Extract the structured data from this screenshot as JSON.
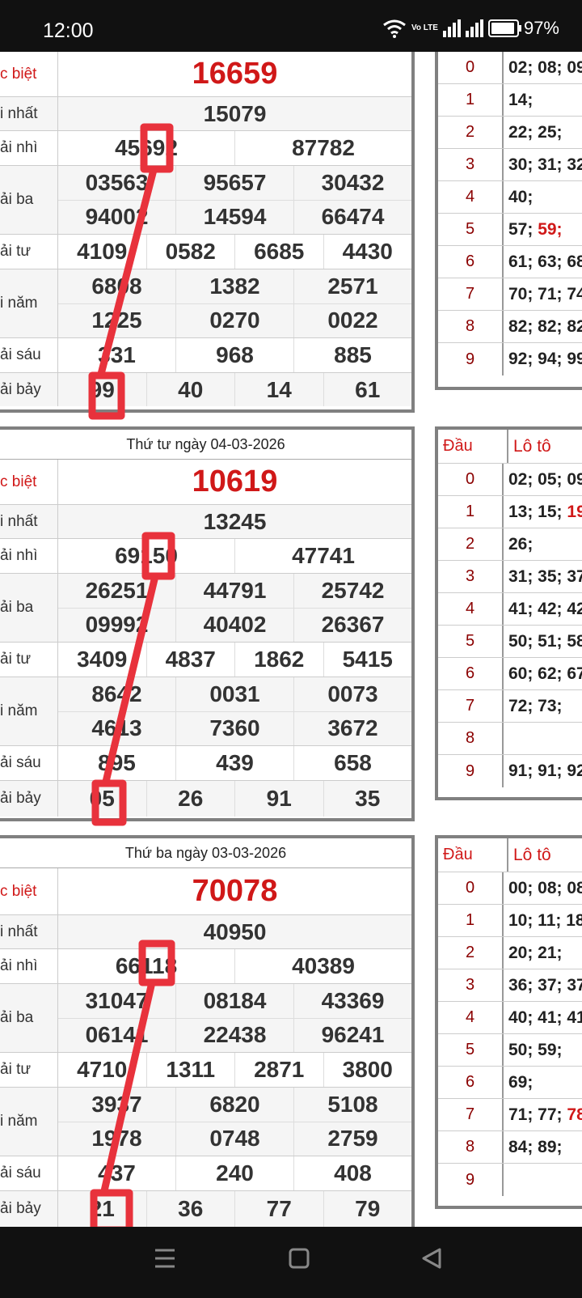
{
  "status": {
    "time": "12:00",
    "network": "Vo LTE",
    "battery": "97%"
  },
  "colors": {
    "accent_red": "#d01818",
    "annotation": "#e8323c"
  },
  "blocks": [
    {
      "title": "",
      "labels": {
        "db": "c biệt",
        "g1": "i nhất",
        "g2": "ải nhì",
        "g3": "ải ba",
        "g4": "ải tư",
        "g5": "i năm",
        "g6": "ải sáu",
        "g7": "ải bảy"
      },
      "db": "16659",
      "g1": "15079",
      "g2": [
        "45692",
        "87782"
      ],
      "g3a": [
        "03563",
        "95657",
        "30432"
      ],
      "g3b": [
        "94002",
        "14594",
        "66474"
      ],
      "g4": [
        "4109",
        "0582",
        "6685",
        "4430"
      ],
      "g5a": [
        "6808",
        "1382",
        "2571"
      ],
      "g5b": [
        "1225",
        "0270",
        "0022"
      ],
      "g6": [
        "331",
        "968",
        "885"
      ],
      "g7": [
        "99",
        "40",
        "14",
        "61"
      ]
    },
    {
      "title": "Thứ tư ngày 04-03-2026",
      "labels": {
        "db": "c biệt",
        "g1": "i nhất",
        "g2": "ải nhì",
        "g3": "ải ba",
        "g4": "ải tư",
        "g5": "i năm",
        "g6": "ải sáu",
        "g7": "ải bảy"
      },
      "db": "10619",
      "g1": "13245",
      "g2": [
        "69150",
        "47741"
      ],
      "g3a": [
        "26251",
        "44791",
        "25742"
      ],
      "g3b": [
        "09992",
        "40402",
        "26367"
      ],
      "g4": [
        "3409",
        "4837",
        "1862",
        "5415"
      ],
      "g5a": [
        "8642",
        "0031",
        "0073"
      ],
      "g5b": [
        "4613",
        "7360",
        "3672"
      ],
      "g6": [
        "895",
        "439",
        "658"
      ],
      "g7": [
        "05",
        "26",
        "91",
        "35"
      ]
    },
    {
      "title": "Thứ ba ngày 03-03-2026",
      "labels": {
        "db": "c biệt",
        "g1": "i nhất",
        "g2": "ải nhì",
        "g3": "ải ba",
        "g4": "ải tư",
        "g5": "i năm",
        "g6": "ải sáu",
        "g7": "ải bảy"
      },
      "db": "70078",
      "g1": "40950",
      "g2": [
        "66118",
        "40389"
      ],
      "g3a": [
        "31047",
        "08184",
        "43369"
      ],
      "g3b": [
        "06141",
        "22438",
        "96241"
      ],
      "g4": [
        "4710",
        "1311",
        "2871",
        "3800"
      ],
      "g5a": [
        "3937",
        "6820",
        "5108"
      ],
      "g5b": [
        "1978",
        "0748",
        "2759"
      ],
      "g6": [
        "437",
        "240",
        "408"
      ],
      "g7": [
        "21",
        "36",
        "77",
        "79"
      ]
    }
  ],
  "lotos": [
    {
      "head": null,
      "rows": [
        {
          "d": "0",
          "v": "02; 08; 09"
        },
        {
          "d": "1",
          "v": "14;"
        },
        {
          "d": "2",
          "v": "22; 25;"
        },
        {
          "d": "3",
          "v": "30; 31; 32"
        },
        {
          "d": "4",
          "v": "40;"
        },
        {
          "d": "5",
          "v": "57;",
          "hl": "59;"
        },
        {
          "d": "6",
          "v": "61; 63; 68"
        },
        {
          "d": "7",
          "v": "70; 71; 74"
        },
        {
          "d": "8",
          "v": "82; 82; 82"
        },
        {
          "d": "9",
          "v": "92; 94; 99"
        }
      ]
    },
    {
      "head": {
        "d": "Đầu",
        "v": "Lô tô"
      },
      "rows": [
        {
          "d": "0",
          "v": "02; 05; 09"
        },
        {
          "d": "1",
          "v": "13; 15;",
          "hl": "19"
        },
        {
          "d": "2",
          "v": "26;"
        },
        {
          "d": "3",
          "v": "31; 35; 37"
        },
        {
          "d": "4",
          "v": "41; 42; 42"
        },
        {
          "d": "5",
          "v": "50; 51; 58"
        },
        {
          "d": "6",
          "v": "60; 62; 67"
        },
        {
          "d": "7",
          "v": "72; 73;"
        },
        {
          "d": "8",
          "v": ""
        },
        {
          "d": "9",
          "v": "91; 91; 92"
        }
      ]
    },
    {
      "head": {
        "d": "Đầu",
        "v": "Lô tô"
      },
      "rows": [
        {
          "d": "0",
          "v": "00; 08; 08"
        },
        {
          "d": "1",
          "v": "10; 11; 18"
        },
        {
          "d": "2",
          "v": "20; 21;"
        },
        {
          "d": "3",
          "v": "36; 37; 37"
        },
        {
          "d": "4",
          "v": "40; 41; 41"
        },
        {
          "d": "5",
          "v": "50; 59;"
        },
        {
          "d": "6",
          "v": "69;"
        },
        {
          "d": "7",
          "v": "71; 77;",
          "hl": "78"
        },
        {
          "d": "8",
          "v": "84; 89;"
        },
        {
          "d": "9",
          "v": ""
        }
      ]
    }
  ]
}
